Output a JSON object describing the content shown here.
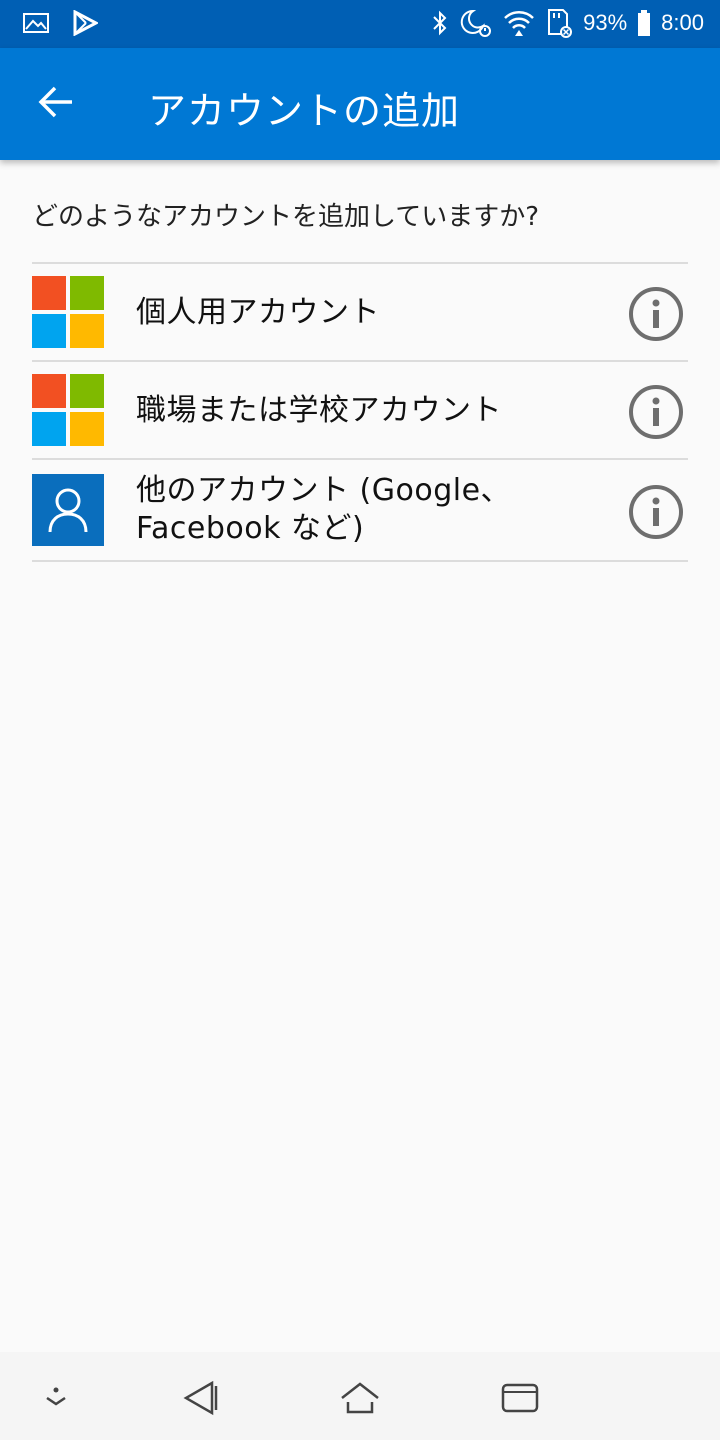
{
  "status_bar": {
    "battery": "93%",
    "time": "8:00",
    "left_icons": [
      "image-icon",
      "play-store-icon"
    ],
    "right_icons": [
      "bluetooth-icon",
      "do-not-disturb-alarm-icon",
      "wifi-icon",
      "sd-card-icon",
      "battery-icon"
    ]
  },
  "app_bar": {
    "title": "アカウントの追加",
    "back_icon": "arrow-back-icon"
  },
  "content": {
    "question": "どのようなアカウントを追加していますか?",
    "accounts": [
      {
        "label": "個人用アカウント",
        "icon": "microsoft-logo-icon"
      },
      {
        "label": "職場または学校アカウント",
        "icon": "microsoft-logo-icon"
      },
      {
        "label_line1": "他のアカウント (Google、",
        "label_line2": "Facebook など)",
        "icon": "person-icon"
      }
    ],
    "info_icon": "info-icon"
  },
  "colors": {
    "status_bar": "#005fb4",
    "app_bar": "#0078d4",
    "ms_red": "#f25022",
    "ms_green": "#7fba00",
    "ms_blue": "#00a4ef",
    "ms_yellow": "#ffb900",
    "person_bg": "#0a6ebd"
  },
  "nav_bar": {
    "buttons": [
      "collapse-icon",
      "back-icon",
      "home-icon",
      "recents-icon"
    ]
  }
}
